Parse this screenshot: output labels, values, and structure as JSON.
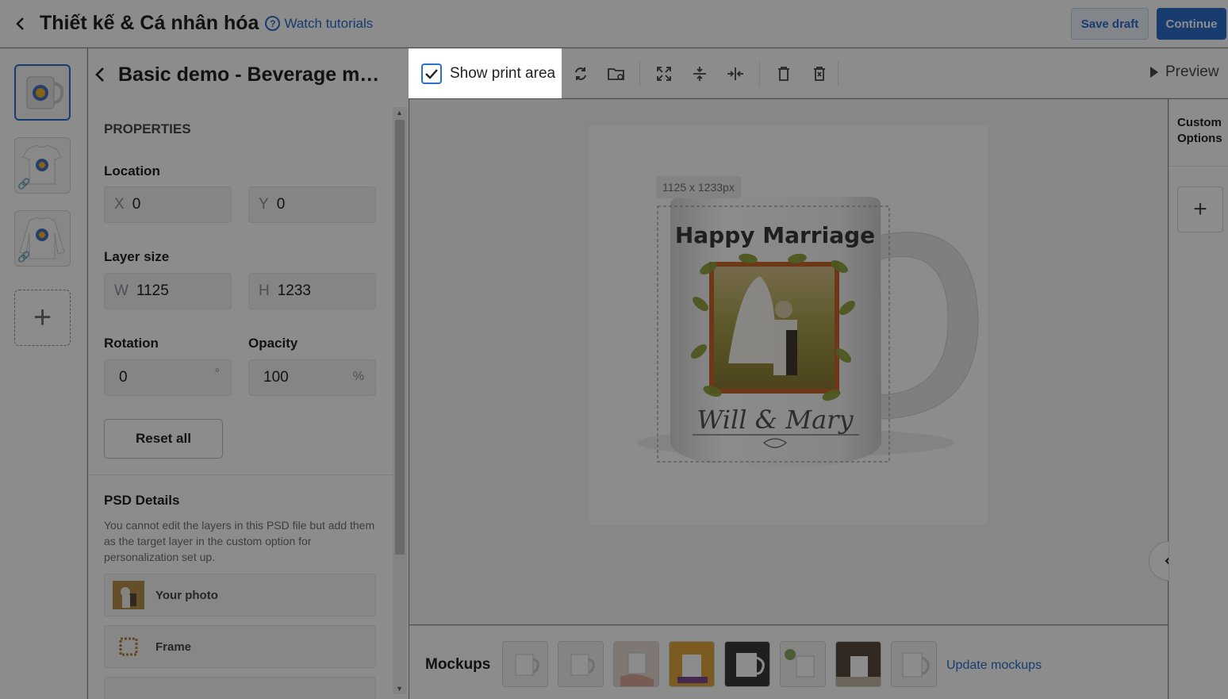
{
  "header": {
    "title": "Thiết kế & Cá nhân hóa",
    "tutorials_label": "Watch tutorials",
    "save_draft_label": "Save draft",
    "continue_label": "Continue"
  },
  "product": {
    "name": "Basic demo - Beverage mu..."
  },
  "properties": {
    "section_title": "PROPERTIES",
    "location_label": "Location",
    "x_prefix": "X",
    "x_value": "0",
    "y_prefix": "Y",
    "y_value": "0",
    "layer_size_label": "Layer size",
    "w_prefix": "W",
    "w_value": "1125",
    "h_prefix": "H",
    "h_value": "1233",
    "rotation_label": "Rotation",
    "rotation_value": "0",
    "rotation_unit": "°",
    "opacity_label": "Opacity",
    "opacity_value": "100",
    "opacity_unit": "%",
    "reset_label": "Reset all"
  },
  "psd": {
    "title": "PSD Details",
    "description": "You cannot edit the layers in this PSD file but add them as the target layer in the custom option for personalization set up.",
    "layers": [
      {
        "label": "Your photo"
      },
      {
        "label": "Frame"
      }
    ]
  },
  "toolbar": {
    "show_print_area_label": "Show print area",
    "show_print_area_checked": true,
    "preview_label": "Preview"
  },
  "canvas": {
    "dimension_label": "1125 x 1233px",
    "mug_text_top": "Happy Marriage",
    "mug_text_bottom": "Will & Mary"
  },
  "custom_options": {
    "title": "Custom Options"
  },
  "mockups": {
    "title": "Mockups",
    "update_label": "Update mockups"
  },
  "colors": {
    "accent": "#2c6ecb",
    "overlay": "rgba(0,0,0,0.45)"
  }
}
